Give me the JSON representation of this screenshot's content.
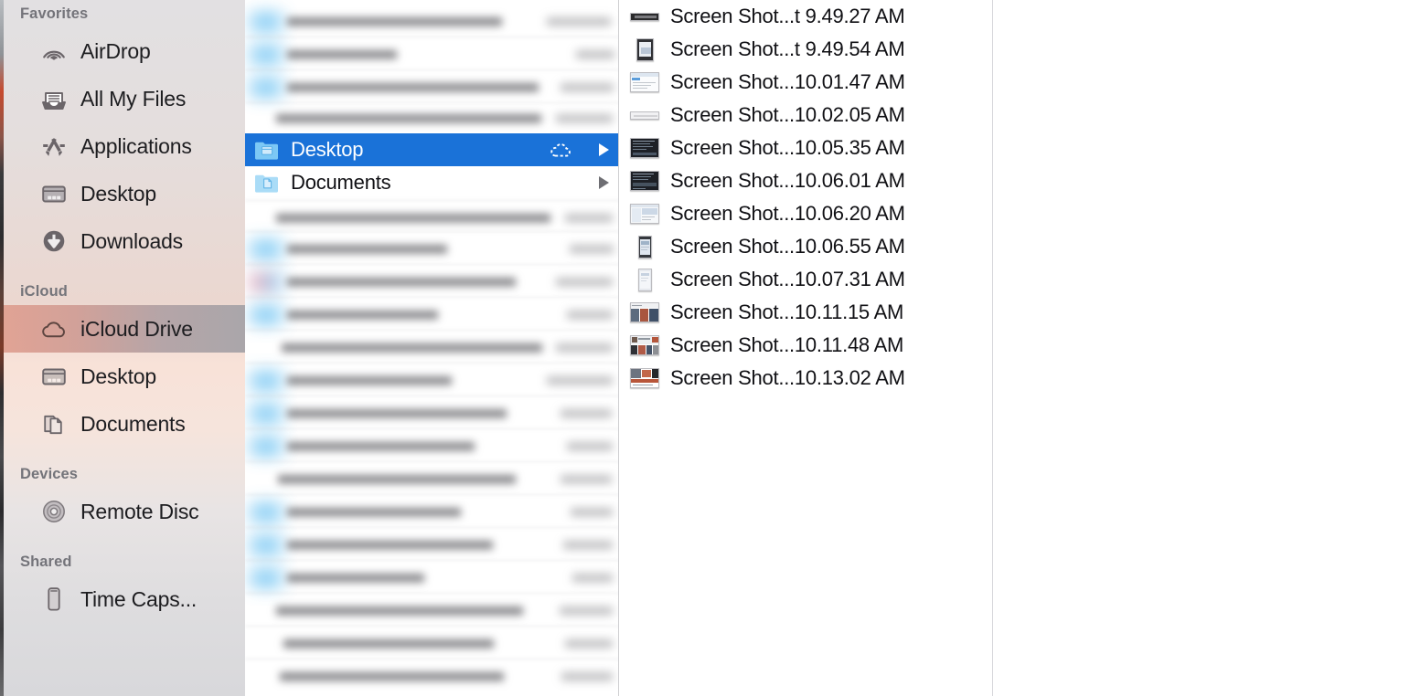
{
  "window": {
    "app": "Finder",
    "view": "column-view"
  },
  "sidebar": {
    "sections": [
      {
        "header": "Favorites",
        "items": [
          {
            "label": "AirDrop",
            "icon": "airdrop-icon",
            "selected": false
          },
          {
            "label": "All My Files",
            "icon": "all-my-files-icon",
            "selected": false
          },
          {
            "label": "Applications",
            "icon": "applications-icon",
            "selected": false
          },
          {
            "label": "Desktop",
            "icon": "desktop-icon",
            "selected": false
          },
          {
            "label": "Downloads",
            "icon": "downloads-icon",
            "selected": false
          }
        ]
      },
      {
        "header": "iCloud",
        "items": [
          {
            "label": "iCloud Drive",
            "icon": "icloud-drive-icon",
            "selected": true
          },
          {
            "label": "Desktop",
            "icon": "desktop-icon",
            "selected": false
          },
          {
            "label": "Documents",
            "icon": "documents-icon",
            "selected": false
          }
        ]
      },
      {
        "header": "Devices",
        "items": [
          {
            "label": "Remote Disc",
            "icon": "remote-disc-icon",
            "selected": false
          }
        ]
      },
      {
        "header": "Shared",
        "items": [
          {
            "label": "Time Caps...",
            "icon": "time-capsule-icon",
            "selected": false
          }
        ]
      }
    ]
  },
  "column_middle": {
    "rows": [
      {
        "label": "Desktop",
        "icon": "folder-icon",
        "selected": true,
        "cloud_status": "cloud-download-icon",
        "disclosure": "chevron-right-icon"
      },
      {
        "label": "Documents",
        "icon": "folder-document-icon",
        "selected": false,
        "cloud_status": "",
        "disclosure": "chevron-right-icon"
      }
    ],
    "obscured_rows_note": "blurred folder rows above and below"
  },
  "column_files": {
    "rows": [
      {
        "name": "Screen Shot...t 9.49.27 AM",
        "thumb": "screenshot-thumb-dark-bar"
      },
      {
        "name": "Screen Shot...t 9.49.54 AM",
        "thumb": "screenshot-thumb-tablet"
      },
      {
        "name": "Screen Shot...10.01.47 AM",
        "thumb": "screenshot-thumb-window-light"
      },
      {
        "name": "Screen Shot...10.02.05 AM",
        "thumb": "screenshot-thumb-slim-light"
      },
      {
        "name": "Screen Shot...10.05.35 AM",
        "thumb": "screenshot-thumb-terminal-dark"
      },
      {
        "name": "Screen Shot...10.06.01 AM",
        "thumb": "screenshot-thumb-terminal-dark"
      },
      {
        "name": "Screen Shot...10.06.20 AM",
        "thumb": "screenshot-thumb-window-light"
      },
      {
        "name": "Screen Shot...10.06.55 AM",
        "thumb": "screenshot-thumb-phone-dark"
      },
      {
        "name": "Screen Shot...10.07.31 AM",
        "thumb": "screenshot-thumb-phone-light"
      },
      {
        "name": "Screen Shot...10.11.15 AM",
        "thumb": "screenshot-thumb-photo-grid"
      },
      {
        "name": "Screen Shot...10.11.48 AM",
        "thumb": "screenshot-thumb-photo-strip"
      },
      {
        "name": "Screen Shot...10.13.02 AM",
        "thumb": "screenshot-thumb-photo-mixed"
      }
    ]
  },
  "colors": {
    "selection_blue": "#1a72d8",
    "sidebar_tint": "#f5e0d6",
    "sidebar_selected_left": "#e0a091",
    "sidebar_selected_right": "#a6a3a8",
    "folder_blue": "#6cc2f2",
    "text_primary": "#101014",
    "text_header": "#74747a"
  }
}
